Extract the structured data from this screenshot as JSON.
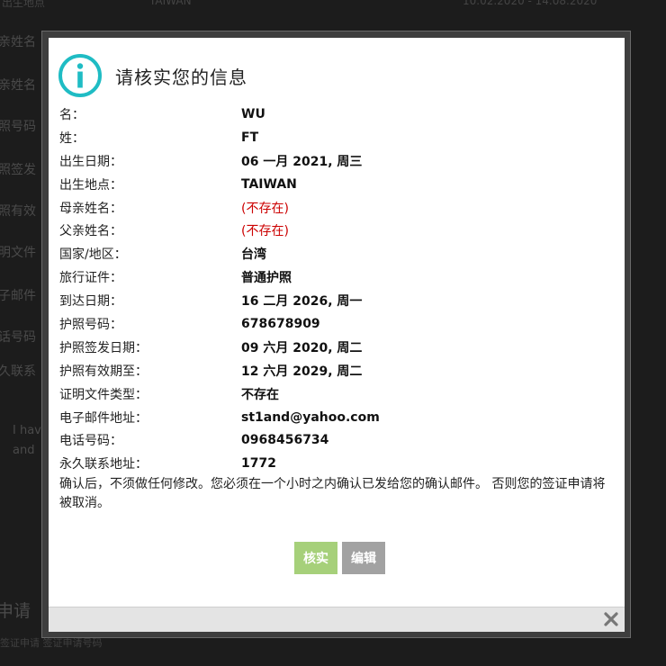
{
  "background": {
    "top_left": "出生地点",
    "top_mid": "TAIWAN",
    "top_right": "10.02.2020 - 14.08.2020",
    "labels": [
      "亲姓名",
      "亲姓名",
      "照号码",
      "照签发",
      "照有效",
      "明文件",
      "子邮件",
      "话号码",
      "久联系"
    ],
    "note_line1": "I hav",
    "note_line2": "and",
    "section_title": "申请",
    "bottom_text": "签证申请                 签证申请号码"
  },
  "modal": {
    "title": "请核实您的信息",
    "fields": [
      {
        "label": "名：",
        "value": "WU"
      },
      {
        "label": "姓：",
        "value": "FT"
      },
      {
        "label": "出生日期：",
        "value": "06 一月 2021, 周三"
      },
      {
        "label": "出生地点：",
        "value": "TAIWAN"
      },
      {
        "label": "母亲姓名：",
        "value": "(不存在)"
      },
      {
        "label": "父亲姓名：",
        "value": "(不存在)"
      },
      {
        "label": "国家/地区：",
        "value": "台湾"
      },
      {
        "label": "旅行证件：",
        "value": "普通护照"
      },
      {
        "label": "到达日期：",
        "value": "16 二月 2026, 周一"
      },
      {
        "label": "护照号码：",
        "value": "678678909"
      },
      {
        "label": "护照签发日期：",
        "value": "09 六月 2020, 周二"
      },
      {
        "label": "护照有效期至：",
        "value": "12 六月 2029, 周二"
      },
      {
        "label": "证明文件类型：",
        "value": "不存在"
      },
      {
        "label": "电子邮件地址：",
        "value": "st1and@yahoo.com"
      },
      {
        "label": "电话号码：",
        "value": "0968456734"
      },
      {
        "label": "永久联系地址：",
        "value": "1772"
      }
    ],
    "notice": "确认后，不须做任何修改。您必须在一个小时之内确认已发给您的确认邮件。 否则您的签证申请将被取消。",
    "verify_label": "核实",
    "edit_label": "编辑"
  },
  "colors": {
    "accent_teal": "#1fbcc4",
    "verify_green": "#a6d07a",
    "edit_gray": "#a2a2a2",
    "missing_red": "#cc0000"
  }
}
